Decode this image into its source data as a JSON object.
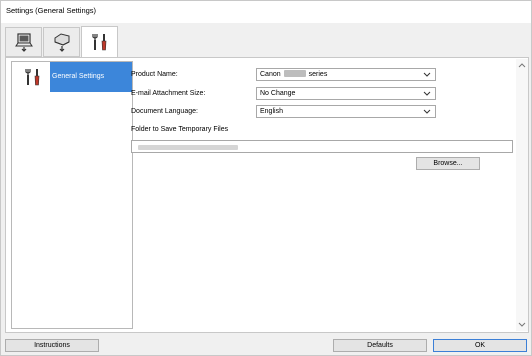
{
  "window": {
    "title": "Settings (General Settings)"
  },
  "tabs": [
    {
      "icon": "computer-scan-icon"
    },
    {
      "icon": "scanner-panel-icon"
    },
    {
      "icon": "tools-icon",
      "active": true
    }
  ],
  "sidebar": {
    "items": [
      {
        "icon": "tools-icon",
        "label": "General Settings",
        "selected": true
      }
    ]
  },
  "form": {
    "product_name": {
      "label": "Product Name:",
      "value_prefix": "Canon",
      "value_suffix": "series"
    },
    "email_size": {
      "label": "E-mail Attachment Size:",
      "value": "No Change"
    },
    "doc_language": {
      "label": "Document Language:",
      "value": "English"
    },
    "temp_folder": {
      "label": "Folder to Save Temporary Files"
    },
    "browse_label": "Browse..."
  },
  "footer": {
    "instructions_label": "Instructions",
    "defaults_label": "Defaults",
    "ok_label": "OK"
  },
  "colors": {
    "selection": "#3c86da",
    "accent_border": "#3c7fd6"
  }
}
